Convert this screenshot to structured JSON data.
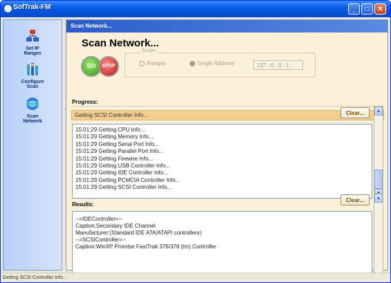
{
  "background_text": [
    ".",
    ",",
    "e",
    "-",
    "t",
    "g"
  ],
  "window": {
    "title": "SofTrak-FM"
  },
  "sidebar": {
    "items": [
      {
        "label_1": "Set IP",
        "label_2": "Ranges",
        "icon": "network-setup-icon"
      },
      {
        "label_1": "Configure",
        "label_2": "Scan",
        "icon": "configure-icon"
      },
      {
        "label_1": "Scan",
        "label_2": "Network",
        "icon": "scan-globe-icon"
      }
    ]
  },
  "panel": {
    "header": "Scan Network...",
    "headline": "Scan Network...",
    "go_label": "GO",
    "stop_label": "STOP",
    "scope": {
      "legend": "Scope",
      "ranges_label": "Ranges",
      "single_label": "Single Address",
      "ip_value": "127 .  0  .  0  .  1"
    },
    "progress_label": "Progress:",
    "progress_text": "Getting SCSI Controller Info...",
    "clear_label": "Clear...",
    "log_lines": [
      "15:01:29  Getting CPU Info...",
      "15:01:29  Getting Memory Info...",
      "15:01:29  Getting Serial Port Info...",
      "15:01:29  Getting Parallel Port Info...",
      "15:01:29  Getting Firewire Info...",
      "15:01:29  Getting USB Controller Info...",
      "15:01:29  Getting IDE Controller Info...",
      "15:01:29  Getting PCMCIA Controller Info...",
      "15:01:29  Getting SCSI Controller Info..."
    ],
    "results_label": "Results:",
    "result_lines": [
      "",
      "--=IDEController=--",
      "",
      "Caption:Secondary IDE Channel",
      "Manufacturer:(Standard IDE ATA/ATAPI controllers)",
      "",
      "--=SCSIController=--",
      "",
      "Caption:WinXP Promise FastTrak 376/378 (tm) Controller"
    ]
  },
  "statusbar": {
    "text": "Getting SCSI Controller Info..."
  },
  "colors": {
    "title_blue": "#0553D8",
    "panel_cream": "#FBF1DA",
    "progress_orange": "#F2CF91"
  }
}
